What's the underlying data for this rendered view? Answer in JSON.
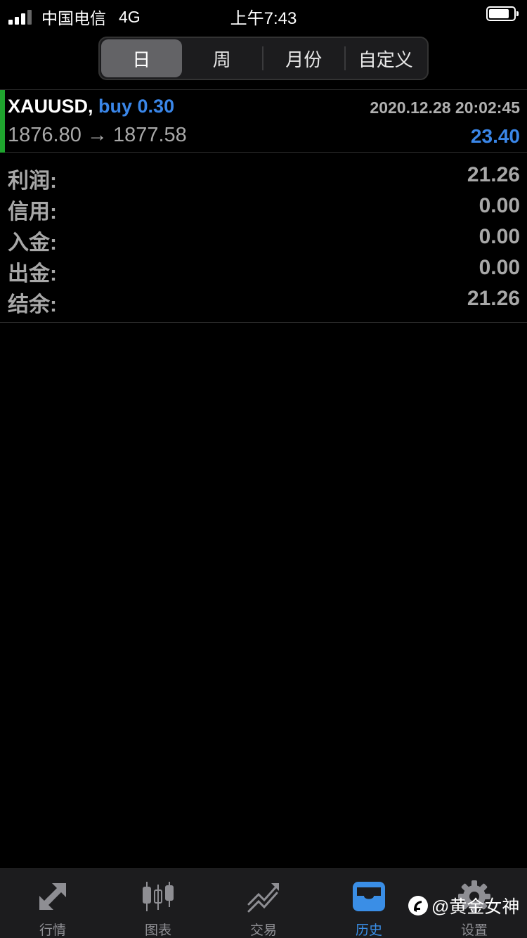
{
  "status_bar": {
    "carrier": "中国电信",
    "network": "4G",
    "time": "上午7:43"
  },
  "period_tabs": [
    {
      "label": "日",
      "active": true
    },
    {
      "label": "周",
      "active": false
    },
    {
      "label": "月份",
      "active": false
    },
    {
      "label": "自定义",
      "active": false
    }
  ],
  "deal": {
    "symbol": "XAUUSD,",
    "side": "buy 0.30",
    "time": "2020.12.28 20:02:45",
    "prices": "1876.80 → 1877.58",
    "profit": "23.40",
    "accent_color": "#1fa52e"
  },
  "summary": [
    {
      "label": "利润:",
      "value": "21.26"
    },
    {
      "label": "信用:",
      "value": "0.00"
    },
    {
      "label": "入金:",
      "value": "0.00"
    },
    {
      "label": "出金:",
      "value": "0.00"
    },
    {
      "label": "结余:",
      "value": "21.26"
    }
  ],
  "tabbar": [
    {
      "label": "行情",
      "icon": "quotes-arrows-icon",
      "active": false
    },
    {
      "label": "图表",
      "icon": "candlestick-chart-icon",
      "active": false
    },
    {
      "label": "交易",
      "icon": "trade-trend-icon",
      "active": false
    },
    {
      "label": "历史",
      "icon": "history-inbox-icon",
      "active": true
    },
    {
      "label": "设置",
      "icon": "gear-icon",
      "active": false
    }
  ],
  "watermark": {
    "text": "@黄金女神"
  },
  "colors": {
    "accent_blue": "#3a86e8",
    "tab_active": "#3a8ee6",
    "buy_green": "#1fa52e"
  }
}
